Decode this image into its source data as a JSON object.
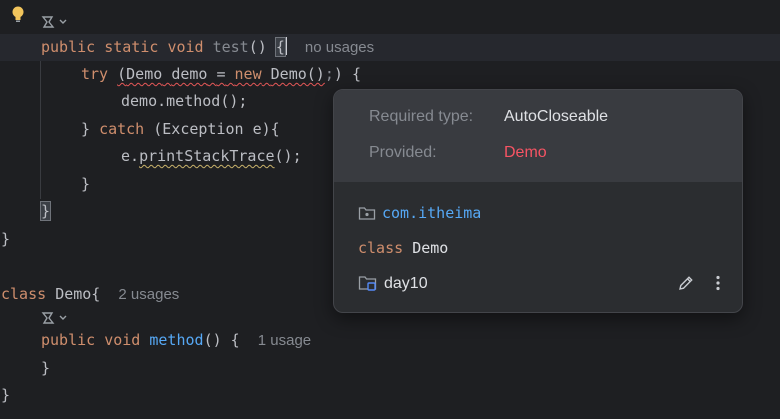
{
  "editor": {
    "method_sig": {
      "kw1": "public",
      "kw2": "static",
      "kw3": "void",
      "name": "test",
      "params": "()",
      "brace": "{",
      "usages_hint": "no usages"
    },
    "try_line": {
      "kw": "try",
      "open": "(",
      "type": "Demo",
      "var": "demo",
      "eq": "=",
      "new_kw": "new",
      "ctor": "Demo()",
      "semi": ";",
      "close": ")",
      "brace": "{"
    },
    "method_call": "demo.method();",
    "catch_line": {
      "close_brace": "}",
      "kw": "catch",
      "params": "(Exception e){"
    },
    "print_line": {
      "prefix": "e.",
      "call": "printStackTrace",
      "suffix": "();"
    },
    "inner_close": "}",
    "method_close": "}",
    "class_close_1": "}",
    "class_decl": {
      "kw": "class",
      "name": "Demo{",
      "usages_hint": "2 usages"
    },
    "method_decl": {
      "kw1": "public",
      "kw2": "void",
      "name": "method",
      "rest": "() {",
      "usages_hint": "1 usage"
    },
    "method2_close": "}",
    "class_close_2": "}"
  },
  "popup": {
    "required_label": "Required type:",
    "required_value": "AutoCloseable",
    "provided_label": "Provided:",
    "provided_value": "Demo",
    "package_name": "com.itheima",
    "class_kw": "class",
    "class_name": "Demo",
    "module_name": "day10"
  },
  "colors": {
    "background": "#1e1f22",
    "keyword": "#cf8e6d",
    "function": "#56a8f5",
    "error": "#f75464",
    "popup_bg": "#2b2d30"
  }
}
